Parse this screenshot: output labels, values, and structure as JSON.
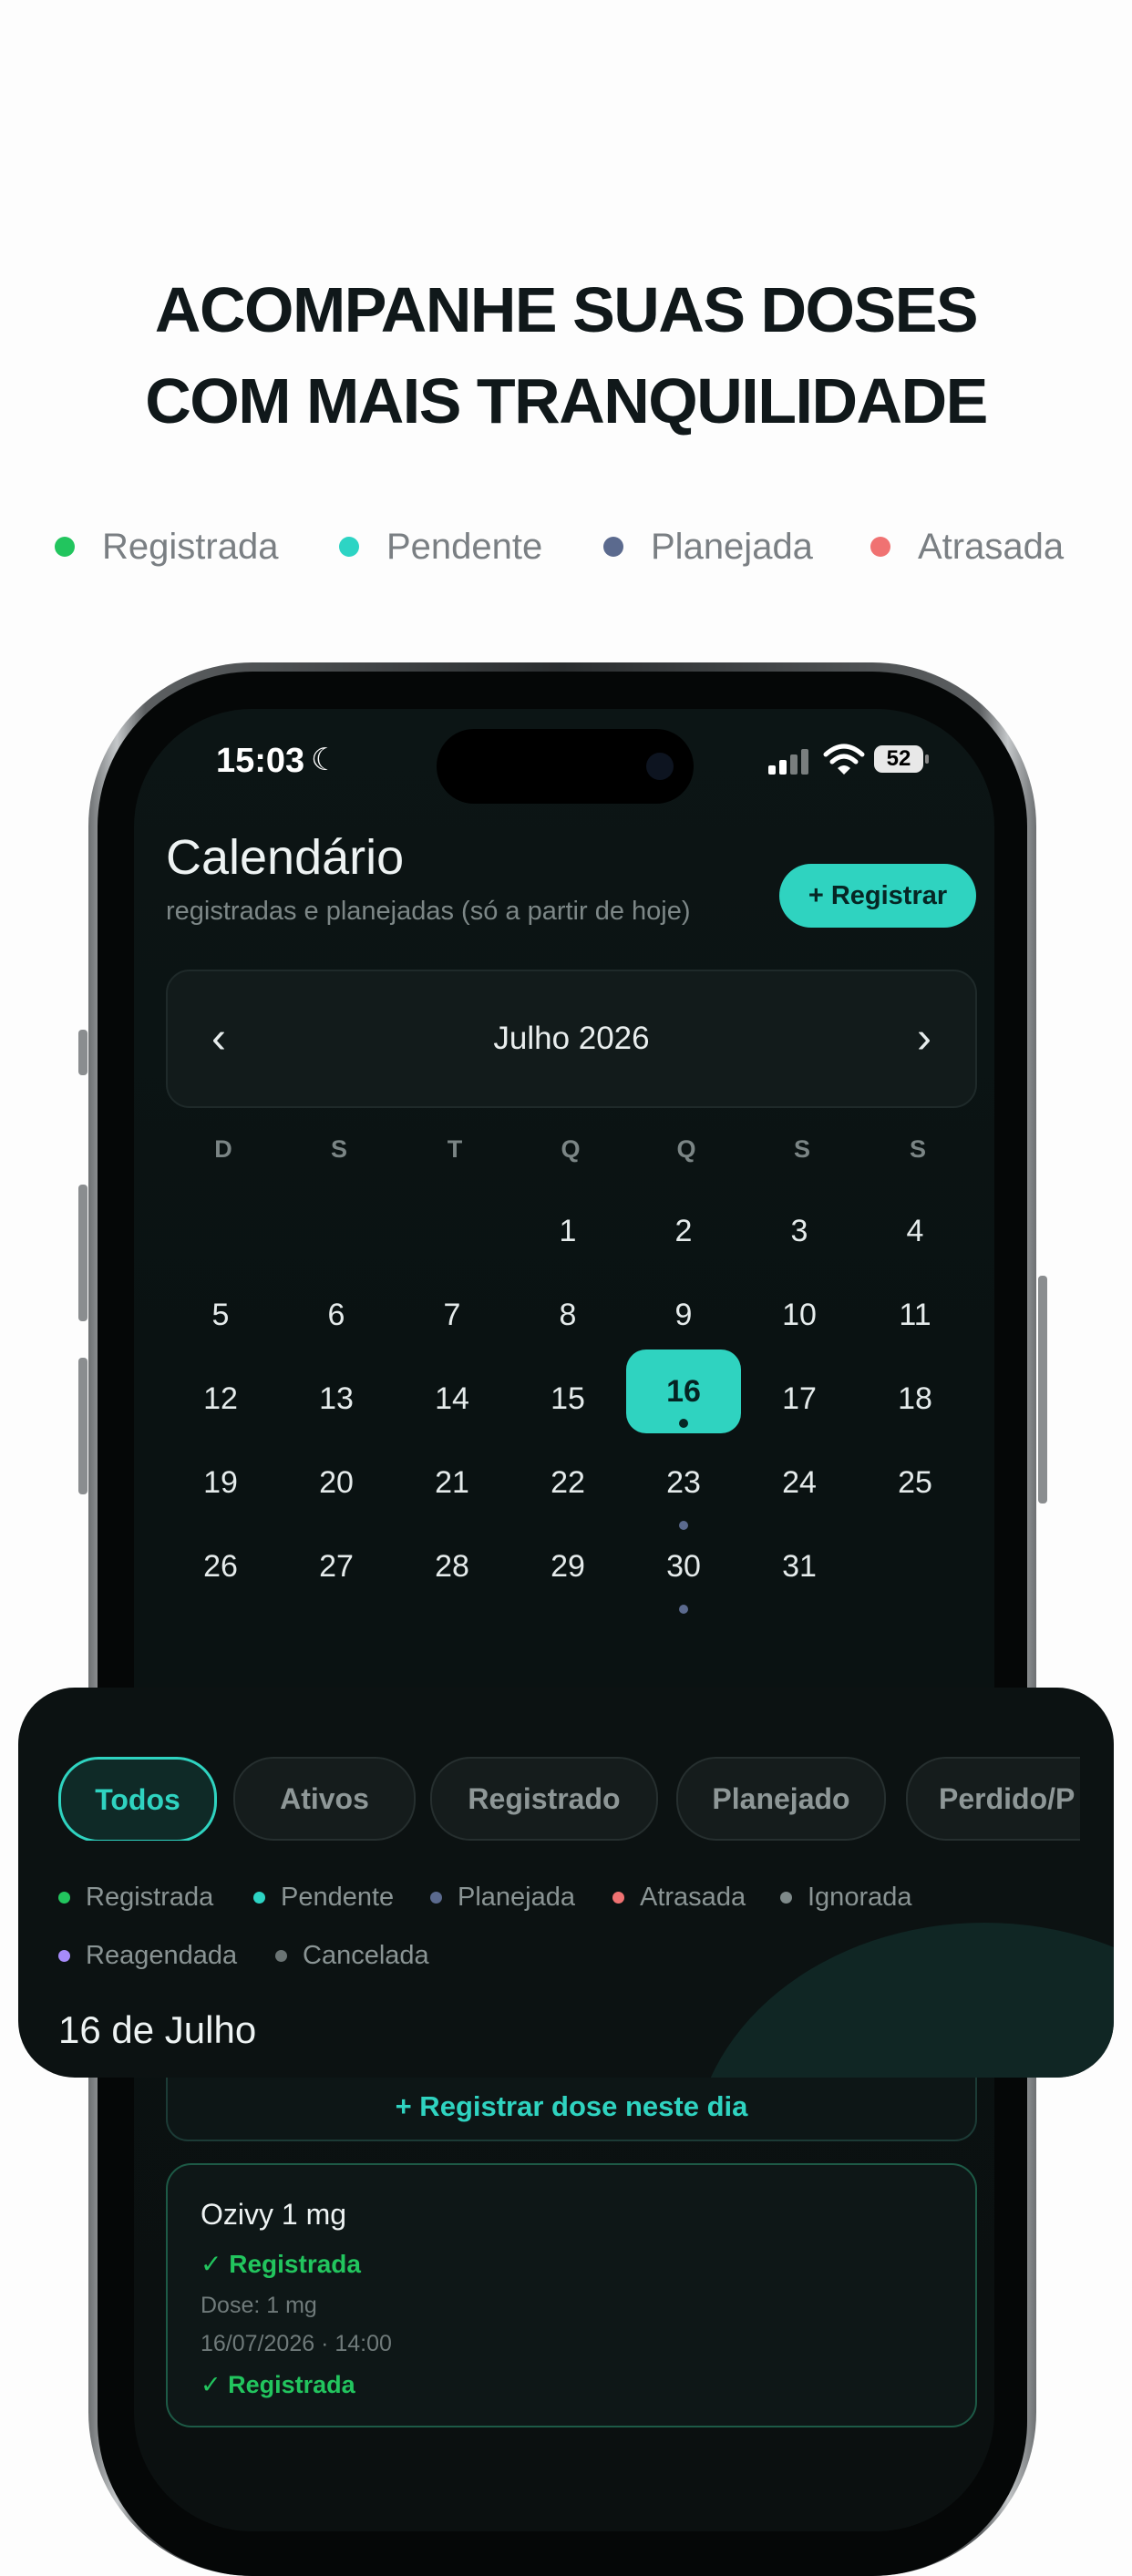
{
  "headline": {
    "line1": "ACOMPANHE SUAS DOSES",
    "line2": "COM MAIS TRANQUILIDADE"
  },
  "top_legend": [
    {
      "label": "Registrada",
      "color": "#22c55e"
    },
    {
      "label": "Pendente",
      "color": "#2dd4c4"
    },
    {
      "label": "Planejada",
      "color": "#5b6a8e"
    },
    {
      "label": "Atrasada",
      "color": "#f07272"
    }
  ],
  "status_bar": {
    "time": "15:03",
    "moon": "☾",
    "battery": "52"
  },
  "header": {
    "title": "Calendário",
    "subtitle": "registradas e planejadas (só a partir de hoje)",
    "register_button": "+ Registrar"
  },
  "calendar": {
    "month_label": "Julho 2026",
    "prev": "‹",
    "next": "›",
    "weekdays": [
      "D",
      "S",
      "T",
      "Q",
      "Q",
      "S",
      "S"
    ],
    "days": [
      "1",
      "2",
      "3",
      "4",
      "5",
      "6",
      "7",
      "8",
      "9",
      "10",
      "11",
      "12",
      "13",
      "14",
      "15",
      "16",
      "17",
      "18",
      "19",
      "20",
      "21",
      "22",
      "23",
      "24",
      "25",
      "26",
      "27",
      "28",
      "29",
      "30",
      "31"
    ],
    "selected_day": "16",
    "accent_color": "#2fd3c0"
  },
  "filters": {
    "chips": [
      "Todos",
      "Ativos",
      "Registrado",
      "Planejado",
      "Perdido/P"
    ],
    "active": "Todos"
  },
  "status_legend": [
    {
      "label": "Registrada",
      "color": "#22c55e"
    },
    {
      "label": "Pendente",
      "color": "#2dd4c4"
    },
    {
      "label": "Planejada",
      "color": "#5b6a8e"
    },
    {
      "label": "Atrasada",
      "color": "#f07272"
    },
    {
      "label": "Ignorada",
      "color": "#7f8a8a"
    },
    {
      "label": "Reagendada",
      "color": "#a78bfa"
    },
    {
      "label": "Cancelada",
      "color": "#6b7474"
    }
  ],
  "selected_date_title": "16 de Julho",
  "register_day_button": "+ Registrar dose neste dia",
  "dose_card": {
    "medication": "Ozivy 1 mg",
    "status": "✓ Registrada",
    "dose": "Dose: 1 mg",
    "datetime": "16/07/2026 · 14:00",
    "status_footer": "✓ Registrada"
  }
}
